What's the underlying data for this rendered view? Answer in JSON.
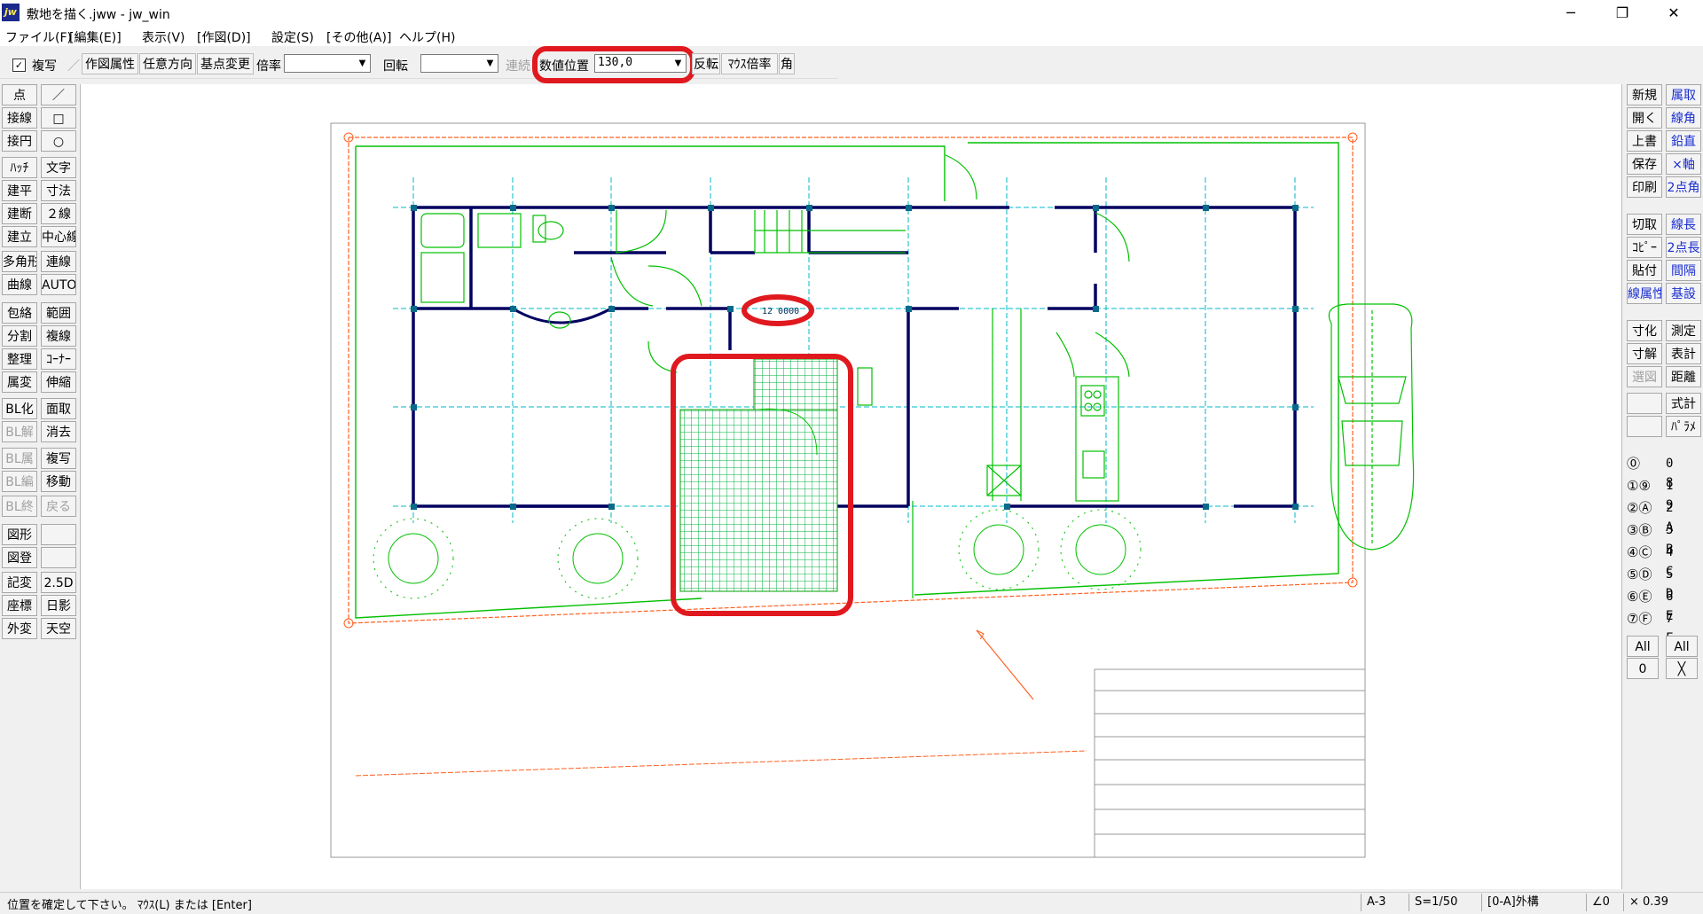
{
  "window": {
    "title": "敷地を描く.jww - jw_win",
    "icon_label": "jw",
    "minimize": "─",
    "maximize": "❐",
    "close": "✕"
  },
  "menu": [
    "ファイル(F)",
    "[編集(E)]",
    "表示(V)",
    "[作図(D)]",
    "設定(S)",
    "[その他(A)]",
    "ヘルプ(H)"
  ],
  "toolbar": {
    "check_mark": "✓",
    "copy_check": "複写",
    "slash": "／",
    "draw_attr": "作図属性",
    "any_direction": "任意方向",
    "base_change": "基点変更",
    "scale_label": "倍率",
    "scale_value": "",
    "rotate_label": "回転",
    "rotate_value": "",
    "continuous": "連続",
    "numeric_pos_label": "数値位置",
    "numeric_pos_value": "130,0",
    "flip": "反転",
    "mouse_scale": "ﾏｳｽ倍率",
    "angle": "角",
    "dropdown_arrow": "▼"
  },
  "left_tools": [
    [
      "点",
      "／"
    ],
    [
      "接線",
      "□"
    ],
    [
      "接円",
      "○"
    ],
    [
      "ﾊｯﾁ",
      "文字"
    ],
    [
      "建平",
      "寸法"
    ],
    [
      "建断",
      "２線"
    ],
    [
      "建立",
      "中心線"
    ],
    [
      "多角形",
      "連線"
    ],
    [
      "曲線",
      "AUTO"
    ],
    [
      "包絡",
      "範囲"
    ],
    [
      "分割",
      "複線"
    ],
    [
      "整理",
      "ｺｰﾅｰ"
    ],
    [
      "属変",
      "伸縮"
    ],
    [
      "BL化",
      "面取"
    ],
    [
      "BL解",
      "消去"
    ],
    [
      "BL属",
      "複写"
    ],
    [
      "BL編",
      "移動"
    ],
    [
      "BL終",
      "戻る"
    ],
    [
      "図形",
      ""
    ],
    [
      "図登",
      ""
    ],
    [
      "記変",
      "2.5D"
    ],
    [
      "座標",
      "日影"
    ],
    [
      "外変",
      "天空"
    ]
  ],
  "right_tools": [
    [
      "新規",
      "属取"
    ],
    [
      "開く",
      "線角"
    ],
    [
      "上書",
      "鉛直"
    ],
    [
      "保存",
      "×軸"
    ],
    [
      "印刷",
      "2点角"
    ],
    [
      "切取",
      "線長"
    ],
    [
      "ｺﾋﾟｰ",
      "2点長"
    ],
    [
      "貼付",
      "間隔"
    ],
    [
      "線属性",
      "基設"
    ],
    [
      "寸化",
      "測定"
    ],
    [
      "寸解",
      "表計"
    ],
    [
      "選図",
      "距離"
    ],
    [
      "",
      "式計"
    ],
    [
      "",
      "ﾊﾟﾗﾒ"
    ]
  ],
  "layer_groups": {
    "left": [
      "⓪",
      "①⑨",
      "②Ⓐ",
      "③Ⓑ",
      "④Ⓒ",
      "⑤Ⓓ",
      "⑥Ⓔ",
      "⑦Ⓕ"
    ],
    "right": [
      "0 8",
      "1 9",
      "2 A",
      "3 B",
      "4 C",
      "5 D",
      "6 E",
      "7 F"
    ],
    "all_left": "All",
    "all_right": "All",
    "zero": "0",
    "cross": "╳"
  },
  "drawing": {
    "numeric_marker": "12 0000"
  },
  "status": {
    "message": "位置を確定して下さい。 ﾏｳｽ(L) または [Enter]",
    "paper": "A-3",
    "scale": "S=1/50",
    "layer": "[0-A]外構",
    "angle": "∠0",
    "zoom": "× 0.39"
  },
  "colors": {
    "highlight": "#e0191f",
    "building": "#00c000",
    "grid": "#00b8c8",
    "wall": "#000080",
    "site": "#ff6020"
  }
}
